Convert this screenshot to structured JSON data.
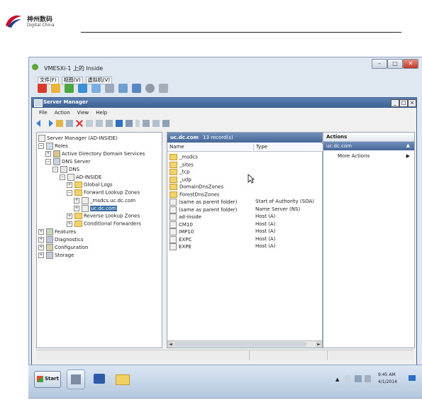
{
  "header": {
    "logo_cn": "神州数码",
    "logo_en": "Digital China"
  },
  "vm": {
    "title": "VMESXi-1 上的 Inside",
    "menu": [
      "文件(F)",
      "视图(V)",
      "虚拟机(V)"
    ]
  },
  "server_manager": {
    "title": "Server Manager",
    "menu": [
      "File",
      "Action",
      "View",
      "Help"
    ],
    "tree": {
      "root": "Server Manager (AD-INSIDE)",
      "roles": "Roles",
      "ad_domain_services": "Active Directory Domain Services",
      "dns_server": "DNS Server",
      "dns": "DNS",
      "ad_inside": "AD-INSIDE",
      "global_logs": "Global Logs",
      "forward_lookup_zones": "Forward Lookup Zones",
      "msdcs_zone": "_msdcs.uc.dc.com",
      "uc_dc_com": "uc.dc.com",
      "reverse_lookup_zones": "Reverse Lookup Zones",
      "conditional_forwarders": "Conditional Forwarders",
      "features": "Features",
      "diagnostics": "Diagnostics",
      "configuration": "Configuration",
      "storage": "Storage"
    },
    "list": {
      "zone": "uc.dc.com",
      "record_count": "13 record(s)",
      "col_name": "Name",
      "col_type": "Type",
      "rows": [
        {
          "name": "_msdcs",
          "type": "",
          "icon": "folder"
        },
        {
          "name": "_sites",
          "type": "",
          "icon": "folder"
        },
        {
          "name": "_tcp",
          "type": "",
          "icon": "folder"
        },
        {
          "name": "_udp",
          "type": "",
          "icon": "folder"
        },
        {
          "name": "DomainDnsZones",
          "type": "",
          "icon": "folder"
        },
        {
          "name": "ForestDnsZones",
          "type": "",
          "icon": "folder"
        },
        {
          "name": "(same as parent folder)",
          "type": "Start of Authority (SOA)",
          "icon": "record"
        },
        {
          "name": "(same as parent folder)",
          "type": "Name Server (NS)",
          "icon": "record"
        },
        {
          "name": "ad-inside",
          "type": "Host (A)",
          "icon": "record"
        },
        {
          "name": "CM10",
          "type": "Host (A)",
          "icon": "record"
        },
        {
          "name": "IMP10",
          "type": "Host (A)",
          "icon": "record"
        },
        {
          "name": "EXPC",
          "type": "Host (A)",
          "icon": "record"
        },
        {
          "name": "EXPE",
          "type": "Host (A)",
          "icon": "record"
        }
      ]
    },
    "actions": {
      "title": "Actions",
      "selected": "uc.dc.com",
      "more_actions": "More Actions"
    }
  },
  "taskbar": {
    "start": "Start",
    "time": "9:45 AM",
    "date": "4/1/2014"
  }
}
